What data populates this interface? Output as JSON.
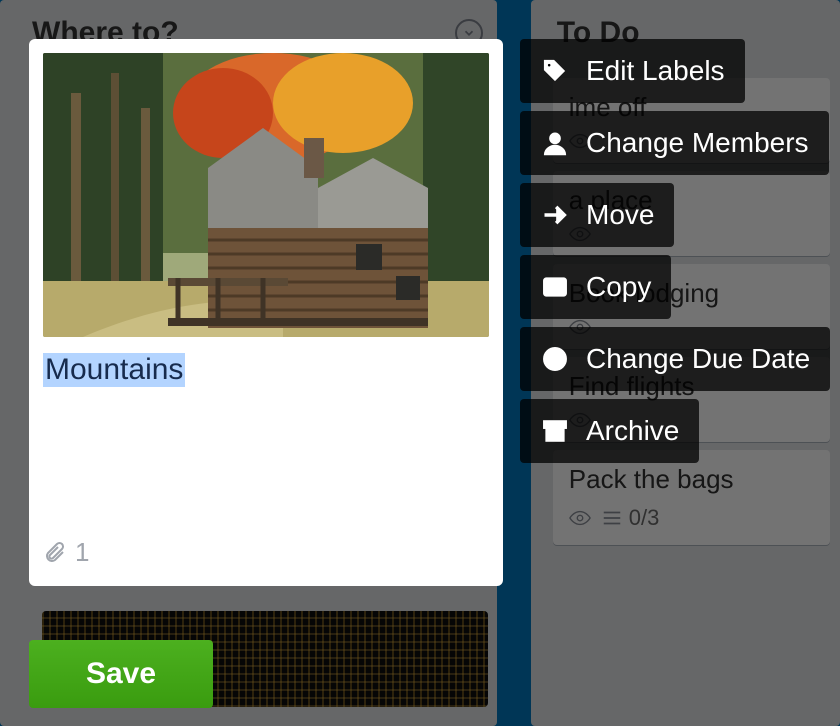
{
  "lists": {
    "left": {
      "title": "Where to?"
    },
    "right": {
      "title": "To Do",
      "cards": [
        {
          "title": "ime off"
        },
        {
          "title": "a place"
        },
        {
          "title": "Book lodging"
        },
        {
          "title": "Find flights"
        },
        {
          "title": "Pack the bags",
          "checklist": "0/3"
        }
      ]
    }
  },
  "editor": {
    "title": "Mountains",
    "attachments": "1"
  },
  "actions": {
    "edit_labels": "Edit Labels",
    "change_members": "Change Members",
    "move": "Move",
    "copy": "Copy",
    "change_due": "Change Due Date",
    "archive": "Archive"
  },
  "save_label": "Save"
}
